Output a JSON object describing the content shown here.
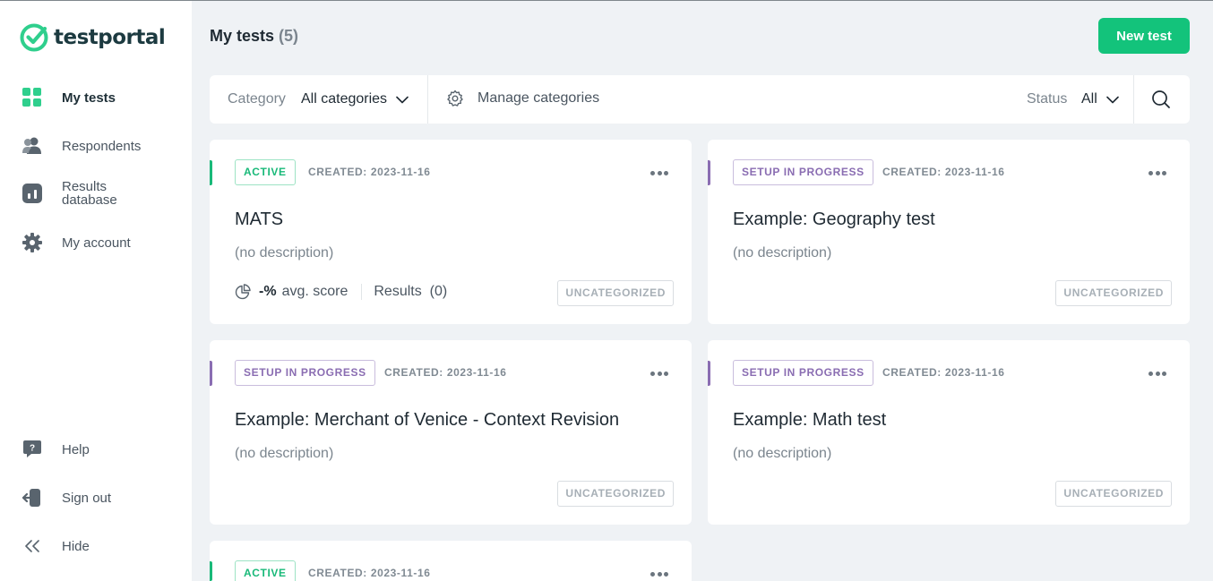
{
  "app": {
    "logo_text": "testportal"
  },
  "sidebar": {
    "items": [
      {
        "label": "My tests",
        "icon": "grid-icon",
        "active": true
      },
      {
        "label": "Respondents",
        "icon": "users-icon"
      },
      {
        "label": "Results\ndatabase",
        "icon": "chart-icon"
      },
      {
        "label": "My account",
        "icon": "gear-icon"
      }
    ],
    "bottom": [
      {
        "label": "Help",
        "icon": "chat-question-icon"
      },
      {
        "label": "Sign out",
        "icon": "sign-out-icon"
      },
      {
        "label": "Hide",
        "icon": "double-chevron-left-icon"
      }
    ]
  },
  "header": {
    "title": "My tests",
    "count": "(5)",
    "new_button": "New test"
  },
  "filters": {
    "category_label": "Category",
    "category_value": "All categories",
    "manage_label": "Manage categories",
    "status_label": "Status",
    "status_value": "All"
  },
  "cards": [
    {
      "status": "ACTIVE",
      "created": "CREATED: 2023-11-16",
      "title": "MATS",
      "description": "(no description)",
      "score": "-%",
      "score_label": "avg. score",
      "results": "Results  (0)",
      "category": "UNCATEGORIZED"
    },
    {
      "status": "SETUP IN PROGRESS",
      "created": "CREATED: 2023-11-16",
      "title": "Example: Geography test",
      "description": "(no description)",
      "category": "UNCATEGORIZED"
    },
    {
      "status": "SETUP IN PROGRESS",
      "created": "CREATED: 2023-11-16",
      "title": "Example: Merchant of Venice - Context Revision",
      "description": "(no description)",
      "category": "UNCATEGORIZED"
    },
    {
      "status": "SETUP IN PROGRESS",
      "created": "CREATED: 2023-11-16",
      "title": "Example: Math test",
      "description": "(no description)",
      "category": "UNCATEGORIZED"
    },
    {
      "status": "ACTIVE",
      "created": "CREATED: 2023-11-16"
    }
  ],
  "colors": {
    "brand_green": "#13c37b",
    "active_green": "#19b979",
    "setup_purple": "#8a6db2",
    "sidebar_icon": "#4a5560"
  }
}
